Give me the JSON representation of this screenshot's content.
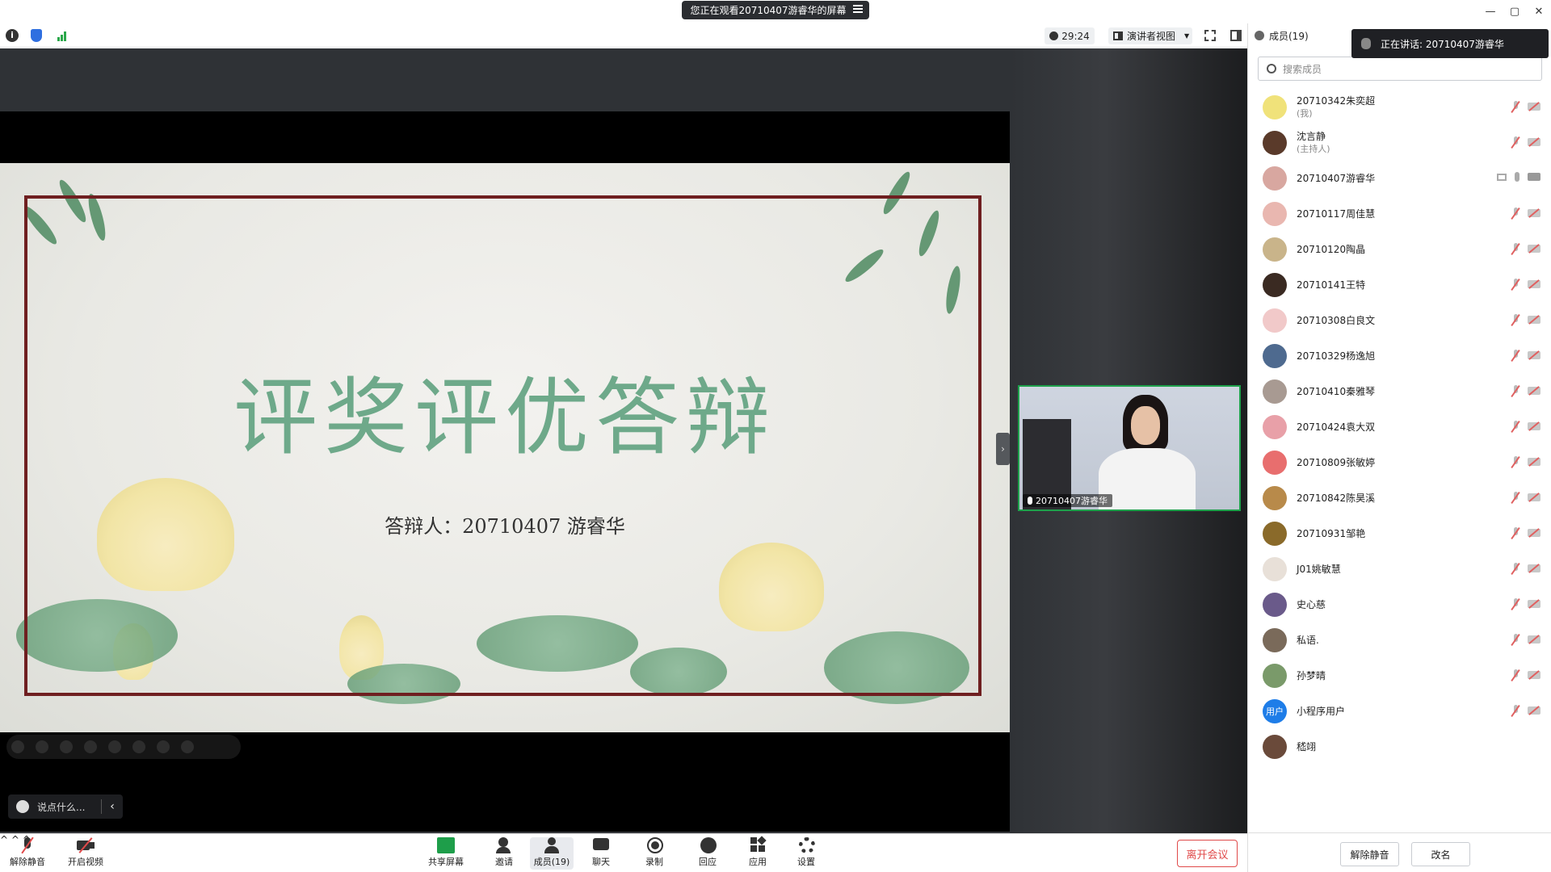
{
  "topbar": {
    "sharing_title": "您正在观看20710407游睿华的屏幕"
  },
  "toolbar": {
    "timer": "29:24",
    "view_mode": "演讲者视图"
  },
  "slide": {
    "title": "评奖评优答辩",
    "subtitle": "答辩人：20710407 游睿华"
  },
  "reaction_bar": {
    "placeholder": "说点什么..."
  },
  "speaker_tile": {
    "name": "20710407游睿华"
  },
  "bottombar": {
    "unmute": "解除静音",
    "start_video": "开启视频",
    "share_screen": "共享屏幕",
    "invite": "邀请",
    "members": "成员(19)",
    "chat": "聊天",
    "record": "录制",
    "reactions": "回应",
    "apps": "应用",
    "settings": "设置",
    "leave": "离开会议"
  },
  "panel": {
    "title": "成员(19)",
    "speaking_toast": "正在讲话: 20710407游睿华",
    "search_placeholder": "搜索成员",
    "footer": {
      "unmute_all": "解除静音",
      "rename": "改名"
    },
    "participants": [
      {
        "name": "20710342朱奕超",
        "role": "(我)",
        "color": "#f0e27a"
      },
      {
        "name": "沈言静",
        "role": "(主持人)",
        "color": "#5a3a2a"
      },
      {
        "name": "20710407游睿华",
        "role": "",
        "color": "#d8a7a0"
      },
      {
        "name": "20710117周佳慧",
        "role": "",
        "color": "#e9b7b0"
      },
      {
        "name": "20710120陶晶",
        "role": "",
        "color": "#c9b48a"
      },
      {
        "name": "20710141王特",
        "role": "",
        "color": "#3a2a22"
      },
      {
        "name": "20710308白良文",
        "role": "",
        "color": "#f1c9c9"
      },
      {
        "name": "20710329杨逸旭",
        "role": "",
        "color": "#4e6a8f"
      },
      {
        "name": "20710410秦雅琴",
        "role": "",
        "color": "#a89a92"
      },
      {
        "name": "20710424袁大双",
        "role": "",
        "color": "#e8a0a8"
      },
      {
        "name": "20710809张敏婷",
        "role": "",
        "color": "#e86e6e"
      },
      {
        "name": "20710842陈昊溪",
        "role": "",
        "color": "#b88a4a"
      },
      {
        "name": "20710931邹艳",
        "role": "",
        "color": "#8a6a2a"
      },
      {
        "name": "J01姚敏慧",
        "role": "",
        "color": "#e8e0d8"
      },
      {
        "name": "史心慈",
        "role": "",
        "color": "#6a5a8a"
      },
      {
        "name": "私语.",
        "role": "",
        "color": "#7a6a5a"
      },
      {
        "name": "孙梦晴",
        "role": "",
        "color": "#7a9a6a"
      },
      {
        "name": "小程序用户",
        "role": "",
        "color": "#1e7de8",
        "badge": "用户"
      },
      {
        "name": "嵇翊",
        "role": "",
        "color": "#6a4a3a"
      }
    ]
  }
}
